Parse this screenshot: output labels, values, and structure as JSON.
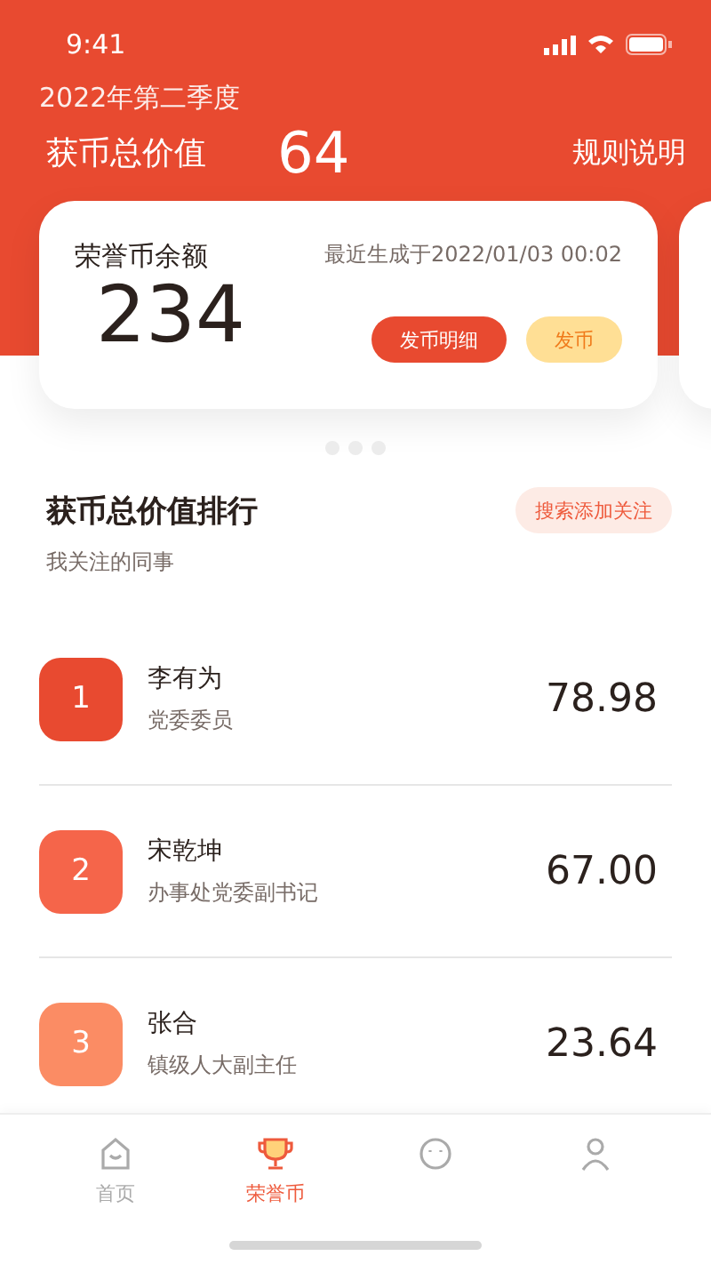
{
  "status_bar": {
    "time": "9:41"
  },
  "header": {
    "period": "2022年第二季度",
    "total_label": "获币总价值",
    "total_value": "64",
    "rules_link": "规则说明"
  },
  "balance_card": {
    "title": "荣誉币余额",
    "updated": "最近生成于2022/01/03 00:02",
    "amount": "234",
    "buttons": [
      {
        "label": "发币明细",
        "kind": "primary"
      },
      {
        "label": "发币",
        "kind": "secondary"
      }
    ]
  },
  "carousel": {
    "dots": [
      {
        "selected": false
      },
      {
        "selected": false
      },
      {
        "selected": false
      }
    ]
  },
  "ranking": {
    "title": "获币总价值排行",
    "subtitle": "我关注的同事",
    "add_button": "搜索添加关注",
    "rows": [
      {
        "rank": "1",
        "name": "李有为",
        "position": "党委委员",
        "value": "78.98",
        "color": "#e84a30"
      },
      {
        "rank": "2",
        "name": "宋乾坤",
        "position": "办事处党委副书记",
        "value": "67.00",
        "color": "#f5654a"
      },
      {
        "rank": "3",
        "name": "张合",
        "position": "镇级人大副主任",
        "value": "23.64",
        "color": "#fb8c64"
      }
    ]
  },
  "tab_bar": [
    {
      "kind": "home",
      "label": "首页",
      "selected": false
    },
    {
      "kind": "trophy",
      "label": "荣誉币",
      "selected": true
    },
    {
      "kind": "face",
      "selected": false
    },
    {
      "kind": "person",
      "selected": false
    }
  ]
}
